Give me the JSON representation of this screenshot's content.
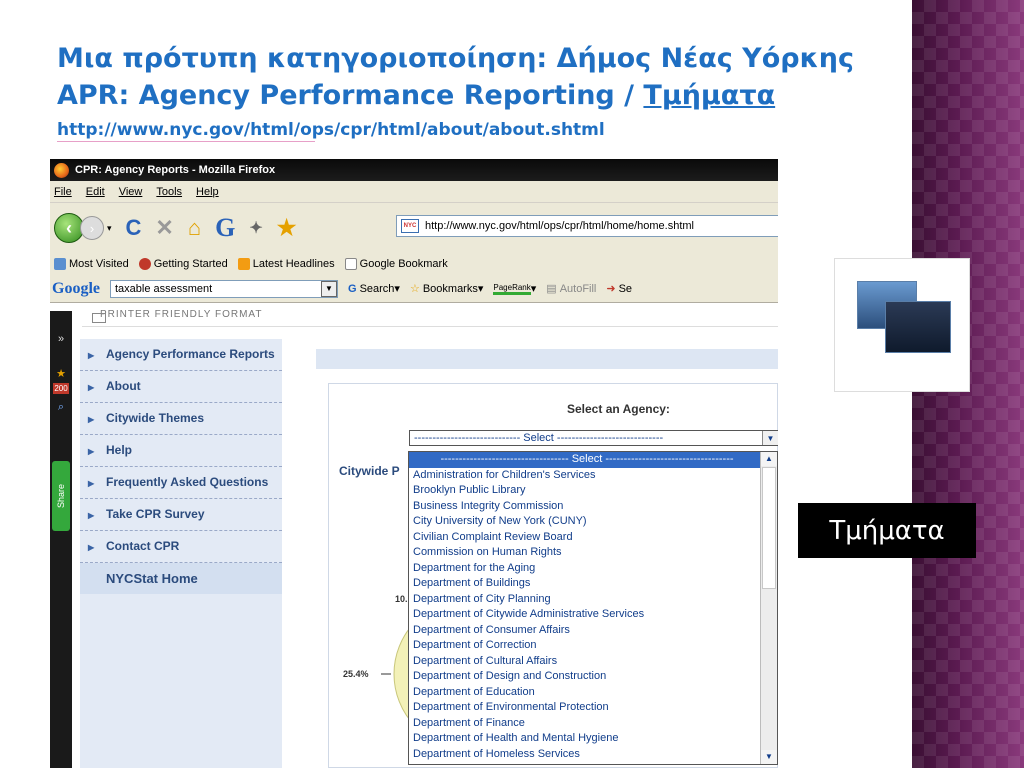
{
  "slide": {
    "title_line1": "Μια πρότυπη κατηγοριοποίηση: Δήμος Νέας Υόρκης",
    "title_line2_prefix": "APR: Agency Performance Reporting / ",
    "title_line2_link": "Τμήματα",
    "url": "http://www.nyc.gov/html/ops/cpr/html/about/about.shtml",
    "side_label": "Τμήματα"
  },
  "browser": {
    "window_title": "CPR: Agency Reports - Mozilla Firefox",
    "menu": [
      "File",
      "Edit",
      "View",
      "Tools",
      "Help"
    ],
    "address": "http://www.nyc.gov/html/ops/cpr/html/home/home.shtml",
    "bookmarks": [
      "Most Visited",
      "Getting Started",
      "Latest Headlines",
      "Google Bookmark"
    ],
    "google_toolbar": {
      "logo": "Google",
      "search_value": "taxable assessment",
      "items": [
        "Search",
        "Bookmarks",
        "PageRank",
        "AutoFill",
        "Se"
      ]
    },
    "printer_friendly": "PRINTER FRIENDLY FORMAT",
    "share_label": "Share",
    "badge_count": "200"
  },
  "nav": {
    "items": [
      "Agency Performance Reports",
      "About",
      "Citywide Themes",
      "Help",
      "Frequently Asked Questions",
      "Take CPR Survey",
      "Contact CPR"
    ],
    "home": "NYCStat Home"
  },
  "main": {
    "select_label": "Select an Agency:",
    "select_value": "----------------------------- Select -----------------------------",
    "citywide_heading": "Citywide P",
    "pie_labels": [
      "10.",
      "25.4%"
    ]
  },
  "dropdown": {
    "options": [
      "----------------------------------- Select -----------------------------------",
      "Administration for Children's Services",
      "Brooklyn Public Library",
      "Business Integrity Commission",
      "City University of New York (CUNY)",
      "Civilian Complaint Review Board",
      "Commission on Human Rights",
      "Department for the Aging",
      "Department of Buildings",
      "Department of City Planning",
      "Department of Citywide Administrative Services",
      "Department of Consumer Affairs",
      "Department of Correction",
      "Department of Cultural Affairs",
      "Department of Design and Construction",
      "Department of Education",
      "Department of Environmental Protection",
      "Department of Finance",
      "Department of Health and Mental Hygiene",
      "Department of Homeless Services"
    ]
  }
}
